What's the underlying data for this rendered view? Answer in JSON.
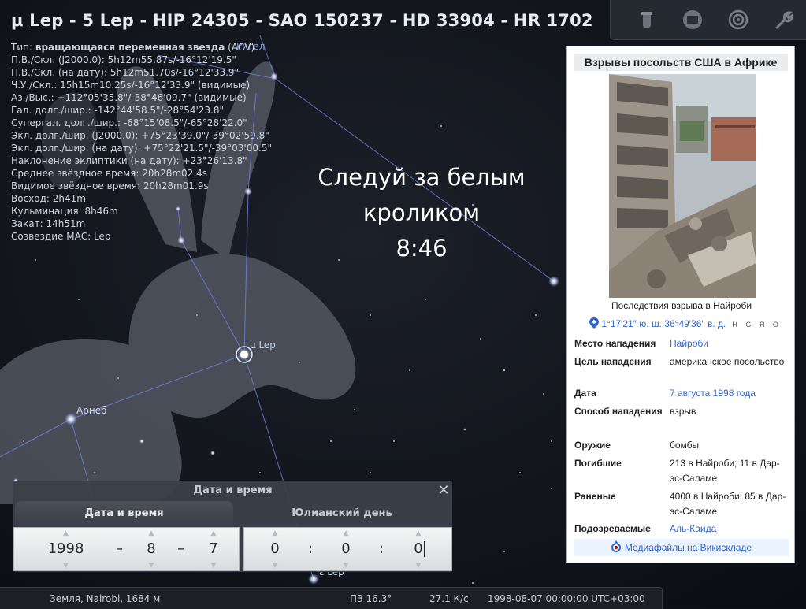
{
  "object_title": "μ Lep - 5 Lep - HIP 24305 - SAO 150237 - HD 33904 - HR 1702",
  "info": {
    "type_label": "Тип: ",
    "type_value": "вращающаяся переменная звезда",
    "type_suffix": " (ACV)",
    "lines": [
      "П.В./Скл. (J2000.0): 5h12m55.87s/-16°12'19.5\"",
      "П.В./Скл. (на дату): 5h12m51.70s/-16°12'33.9\"",
      "Ч.У./Скл.: 15h15m10.25s/-16°12'33.9\" (видимые)",
      "Аз./Выс.: +112°05'35.8\"/-38°46'09.7\" (видимые)",
      "Гал. долг./шир.: -142°44'58.5\"/-28°54'23.8\"",
      "Супергал. долг./шир.: -68°15'08.5\"/-65°28'22.0\"",
      "Экл. долг./шир. (J2000.0): +75°23'39.0\"/-39°02'59.8\"",
      "Экл. долг./шир. (на дату): +75°22'21.5\"/-39°03'00.5\"",
      "Наклонение эклиптики (на дату): +23°26'13.8\"",
      "Среднее звёздное время: 20h28m02.4s",
      "Видимое звёздное время: 20h28m01.9s",
      "Восход: 2h41m",
      "Кульминация: 8h46m",
      "Закат: 14h51m",
      "Созвездие МАС: Lep"
    ]
  },
  "caption": {
    "line1": "Следуй за белым",
    "line2": "кроликом",
    "line3": "8:46"
  },
  "sky_labels": {
    "mu_lep": "μ Lep",
    "arneb": "Арнеб",
    "rigel_partial": "Ригел",
    "lep_bottom": "ε Lep"
  },
  "toolbar": {
    "icons": [
      "telescope-icon",
      "screen-icon",
      "target-icon",
      "wrench-icon"
    ]
  },
  "wiki": {
    "title": "Взрывы посольств США в Африке",
    "photo_caption": "Последствия взрыва в Найроби",
    "coords": "1°17′21″ ю. ш. 36°49′36″ в. д.",
    "geo_links": "H G Я O",
    "rows": [
      {
        "key": "Место нападения",
        "value": "Найроби",
        "link": true
      },
      {
        "key": "Цель нападения",
        "value": "американское посольство",
        "link": false
      },
      {
        "key": "Дата",
        "value": "7 августа 1998 года",
        "link": true
      },
      {
        "key": "Способ нападения",
        "value": "взрыв",
        "link": false
      },
      {
        "key": "Оружие",
        "value": "бомбы",
        "link": false
      },
      {
        "key": "Погибшие",
        "value": "213 в Найроби; 11 в Дар-эс-Саламе",
        "link": false
      },
      {
        "key": "Раненые",
        "value": "4000 в Найроби; 85 в Дар-эс-Саламе",
        "link": false
      },
      {
        "key": "Подозреваемые",
        "value": "Аль-Каида",
        "link": true
      }
    ],
    "commons": "Медиафайлы на Викискладе"
  },
  "datetime_dialog": {
    "title": "Дата и время",
    "close": "✕",
    "tab_date": "Дата и время",
    "tab_julian": "Юлианский день",
    "year": "1998",
    "month": "8",
    "day": "7",
    "date_sep": "–",
    "hour": "0",
    "minute": "0",
    "second": "0",
    "time_sep": ":"
  },
  "status": {
    "location": "Земля, Nairobi, 1684 м",
    "fov": "ПЗ 16.3°",
    "fps": "27.1 К/с",
    "datetime": "1998-08-07 00:00:00 UTC+03:00"
  }
}
